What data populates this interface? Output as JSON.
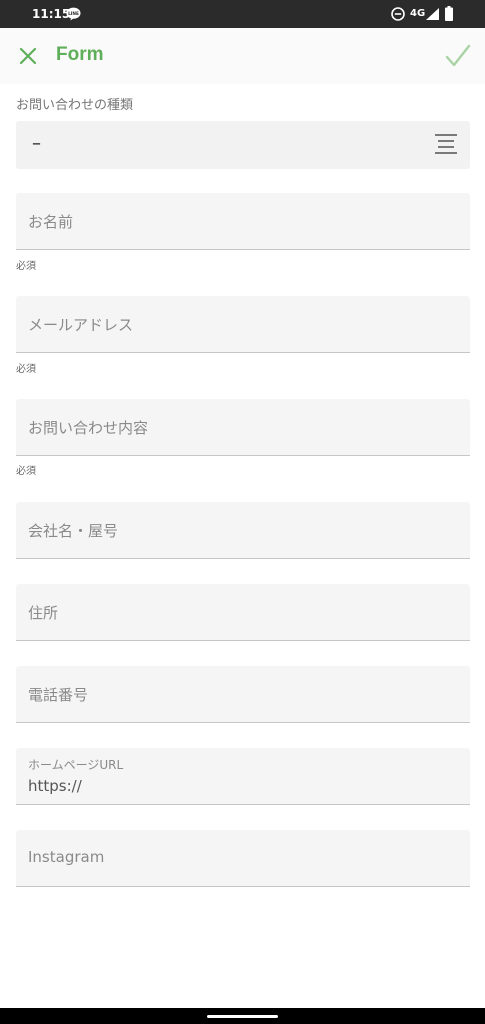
{
  "status_bar": {
    "time": "11:15",
    "network": "4G",
    "icons": [
      "line-icon",
      "do-not-disturb-icon",
      "signal-icon",
      "battery-icon"
    ]
  },
  "app_bar": {
    "title": "Form",
    "close_icon": "close-icon",
    "submit_icon": "check-icon",
    "accent_color": "#5fae5a"
  },
  "inquiry_type": {
    "label": "お問い合わせの種類",
    "value": "–",
    "icon": "list-icon"
  },
  "fields": {
    "name": {
      "placeholder": "お名前",
      "helper": "必須"
    },
    "email": {
      "placeholder": "メールアドレス",
      "helper": "必須"
    },
    "inquiry": {
      "placeholder": "お問い合わせ内容",
      "helper": "必須"
    },
    "company": {
      "placeholder": "会社名・屋号"
    },
    "address": {
      "placeholder": "住所"
    },
    "phone": {
      "placeholder": "電話番号"
    },
    "homepage": {
      "label": "ホームページURL",
      "value": "https://"
    },
    "instagram": {
      "placeholder": "Instagram"
    }
  }
}
